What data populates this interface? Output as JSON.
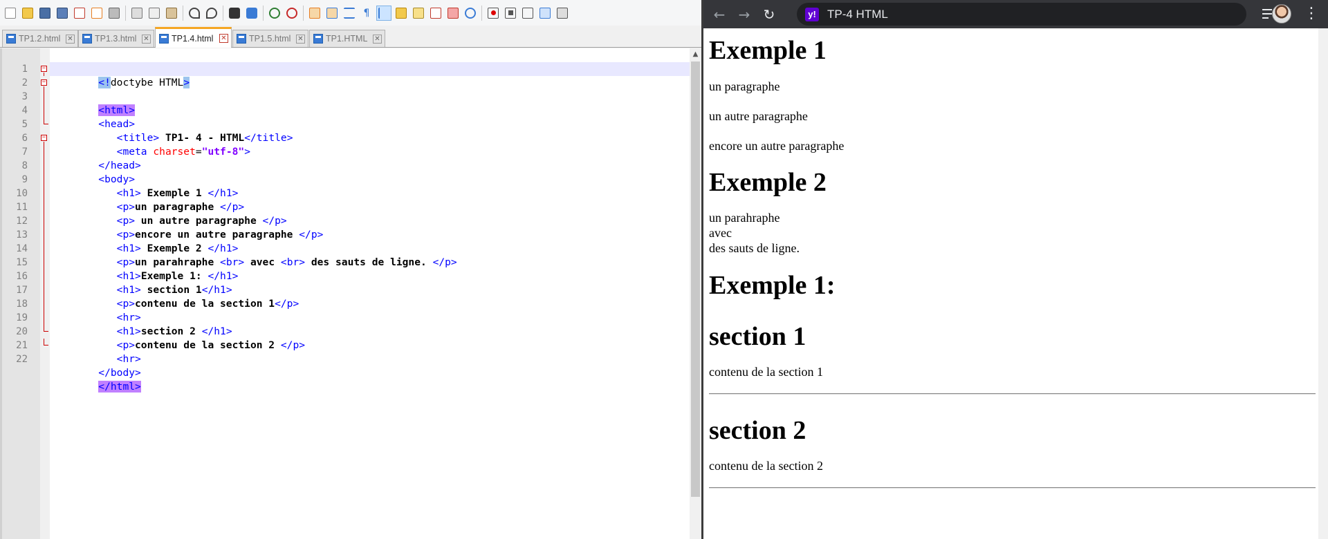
{
  "npp": {
    "toolbar": {
      "icons": [
        "new-file",
        "open-file",
        "save",
        "save-all",
        "close",
        "close-all",
        "print",
        "cut",
        "copy",
        "paste",
        "undo",
        "redo",
        "find",
        "replace",
        "zoom-in",
        "zoom-out",
        "sync-v",
        "sync-h",
        "word-wrap",
        "show-all-chars",
        "indent-guide",
        "doc-map",
        "function-list",
        "folder-as-workspace",
        "monitor",
        "macro-record",
        "macro-stop",
        "macro-play",
        "macro-run-multiple",
        "macro-save"
      ]
    },
    "tabs": [
      {
        "label": "TP1.2.html",
        "active": false
      },
      {
        "label": "TP1.3.html",
        "active": false
      },
      {
        "label": "TP1.4.html",
        "active": true
      },
      {
        "label": "TP1.5.html",
        "active": false
      },
      {
        "label": "TP1.HTML",
        "active": false
      }
    ],
    "editor": {
      "line_numbers": [
        "1",
        "2",
        "3",
        "4",
        "5",
        "6",
        "7",
        "8",
        "9",
        "10",
        "11",
        "12",
        "13",
        "14",
        "15",
        "16",
        "17",
        "18",
        "19",
        "20",
        "21",
        "22"
      ],
      "l1_open": "<!",
      "l1_text": "doctybe HTML",
      "l1_close": ">",
      "l2": "<html>",
      "l3": "<head>",
      "l4_open": "<title>",
      "l4_text": " TP1- 4 - HTML",
      "l4_close": "</title>",
      "l5_open": "<meta ",
      "l5_attr": "charset",
      "l5_eq": "=",
      "l5_val": "\"utf-8\"",
      "l5_close": ">",
      "l6": "</head>",
      "l7": "<body>",
      "l8_open": "<h1>",
      "l8_text": " Exemple 1 ",
      "l8_close": "</h1>",
      "l9_open": "<p>",
      "l9_text": "un paragraphe ",
      "l9_close": "</p>",
      "l10_open": "<p>",
      "l10_text": " un autre paragraphe ",
      "l10_close": "</p>",
      "l11_open": "<p>",
      "l11_text": "encore un autre paragraphe ",
      "l11_close": "</p>",
      "l12_open": "<h1>",
      "l12_text": " Exemple 2 ",
      "l12_close": "</h1>",
      "l13_open": "<p>",
      "l13_t1": "un parahraphe ",
      "l13_br1": "<br>",
      "l13_t2": " avec ",
      "l13_br2": "<br>",
      "l13_t3": " des sauts de ligne. ",
      "l13_close": "</p>",
      "l14_open": "<h1>",
      "l14_text": "Exemple 1: ",
      "l14_close": "</h1>",
      "l15_open": "<h1>",
      "l15_text": " section 1",
      "l15_close": "</h1>",
      "l16_open": "<p>",
      "l16_text": "contenu de la section 1",
      "l16_close": "</p>",
      "l17": "<hr>",
      "l18_open": "<h1>",
      "l18_text": "section 2 ",
      "l18_close": "</h1>",
      "l19_open": "<p>",
      "l19_text": "contenu de la section 2 ",
      "l19_close": "</p>",
      "l20": "<hr>",
      "l21": "</body>",
      "l22": "</html>"
    }
  },
  "chrome": {
    "back_icon": "←",
    "forward_icon": "→",
    "reload_icon": "↻",
    "site_icon_text": "y!",
    "page_title": "TP-4 HTML",
    "menu_glyph": "⋮",
    "page": {
      "h1_1": "Exemple 1",
      "p1": "un paragraphe",
      "p2": "un autre paragraphe",
      "p3": "encore un autre paragraphe",
      "h1_2": "Exemple 2",
      "p4_l1": "un parahraphe",
      "p4_l2": "avec",
      "p4_l3": "des sauts de ligne.",
      "h1_3": "Exemple 1:",
      "h1_4": "section 1",
      "p5": "contenu de la section 1",
      "h1_5": "section 2",
      "p6": "contenu de la section 2"
    }
  }
}
